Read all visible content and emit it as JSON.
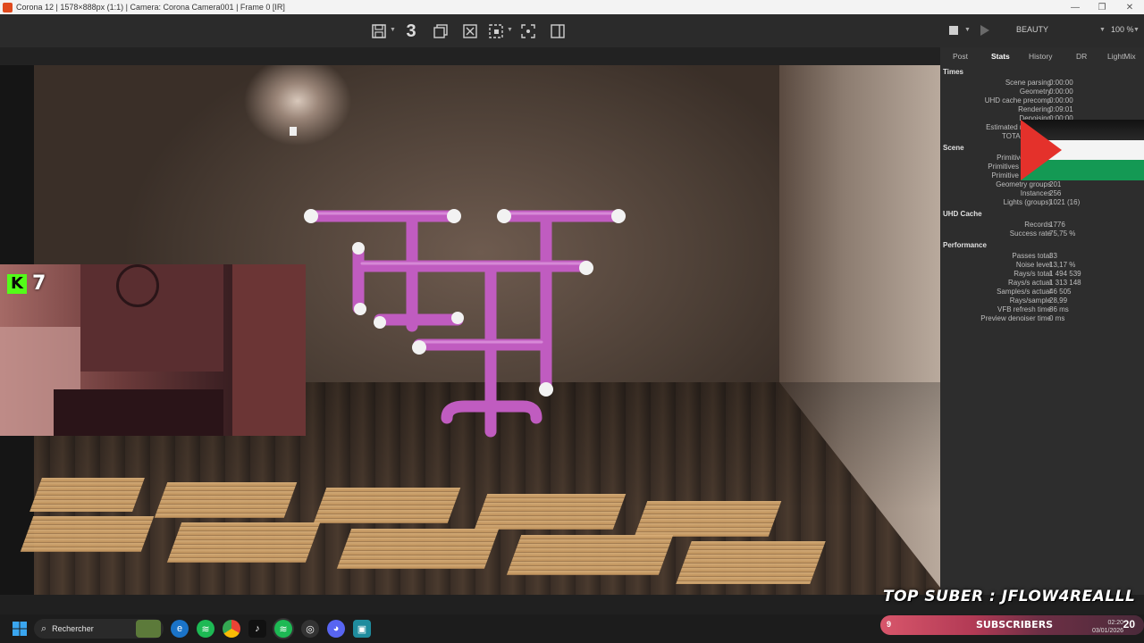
{
  "window": {
    "title": "Corona 12 | 1578×888px (1:1) | Camera: Corona Camera001 | Frame 0 [IR]"
  },
  "toolbar": {
    "pass_count": "3",
    "channel": "BEAUTY",
    "zoom": "100 %"
  },
  "stream": {
    "kick_viewers": "7",
    "top_suber": "TOP SUBER : JFLOW4REALLL",
    "subscribers_label": "SUBSCRIBERS",
    "subscribers_count": "9",
    "subscribers_goal": "20"
  },
  "panel": {
    "tabs": [
      "Post",
      "Stats",
      "History",
      "DR",
      "LightMix"
    ],
    "active_tab": "Stats",
    "times": {
      "title": "Times",
      "rows": [
        {
          "label": "Scene parsing",
          "value": "0:00:00"
        },
        {
          "label": "Geometry",
          "value": "0:00:00"
        },
        {
          "label": "UHD cache precomp",
          "value": "0:00:00"
        },
        {
          "label": "Rendering",
          "value": "0:09:01"
        },
        {
          "label": "Denoising",
          "value": "0:00:00"
        },
        {
          "label": "Estimated remaining",
          "value": ""
        },
        {
          "label": "TOTAL elapsed",
          "value": ""
        }
      ]
    },
    "scene": {
      "title": "Scene",
      "rows": [
        {
          "label": "Primitives unique",
          "value": ""
        },
        {
          "label": "Primitives displaced",
          "value": ""
        },
        {
          "label": "Primitive instances",
          "value": ""
        },
        {
          "label": "Geometry groups",
          "value": "201"
        },
        {
          "label": "Instances",
          "value": "256"
        },
        {
          "label": "Lights (groups)",
          "value": "1021 (16)"
        }
      ]
    },
    "uhd": {
      "title": "UHD Cache",
      "rows": [
        {
          "label": "Records",
          "value": "1776"
        },
        {
          "label": "Success rate",
          "value": "75,75 %"
        }
      ]
    },
    "performance": {
      "title": "Performance",
      "rows": [
        {
          "label": "Passes total",
          "value": "33"
        },
        {
          "label": "Noise level",
          "value": "13,17 %"
        },
        {
          "label": "Rays/s total",
          "value": "1 494 539"
        },
        {
          "label": "Rays/s actual",
          "value": "1 313 148"
        },
        {
          "label": "Samples/s actual",
          "value": "46 505"
        },
        {
          "label": "Rays/sample",
          "value": "28,99"
        },
        {
          "label": "VFB refresh time",
          "value": "86 ms"
        },
        {
          "label": "Preview denoiser time",
          "value": "0 ms"
        }
      ]
    }
  },
  "taskbar": {
    "search_label": "Rechercher",
    "time": "02:20",
    "date": "03/01/2026"
  },
  "colors": {
    "candle": "#c05cc0",
    "kick_green": "#53fc18",
    "corona_orange": "#e04a1e"
  }
}
